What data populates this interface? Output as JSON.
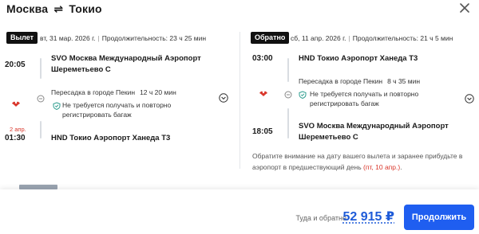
{
  "header": {
    "title_from": "Москва",
    "title_arrow": "⇌",
    "title_to": "Токио"
  },
  "outbound": {
    "badge": "Вылет",
    "date": "вт, 31 мар. 2026 г.",
    "duration": "Продолжительность: 23 ч 25 мин",
    "dep_time": "20:05",
    "dep_place_line1": "SVO Москва Международный Аэропорт",
    "dep_place_line2": "Шереметьево C",
    "transfer_city": "Пересадка в городе Пекин",
    "transfer_duration": "12 ч 20 мин",
    "bag_line1": "Не требуется получать и повторно",
    "bag_line2": "регистрировать багаж",
    "next_day": "2 апр.",
    "arr_time": "01:30",
    "arr_place": "HND Токио Аэропорт Ханеда T3"
  },
  "return": {
    "badge": "Обратно",
    "date": "сб, 11 апр. 2026 г.",
    "duration": "Продолжительность: 21 ч 5 мин",
    "dep_time": "03:00",
    "dep_place": "HND Токио Аэропорт Ханеда T3",
    "transfer_city": "Пересадка в городе Пекин",
    "transfer_duration": "8 ч 35 мин",
    "bag_line1": "Не требуется получать и повторно",
    "bag_line2": "регистрировать багаж",
    "arr_time": "18:05",
    "arr_place_line1": "SVO Москва Международный Аэропорт",
    "arr_place_line2": "Шереметьево C",
    "notice_line1": "Обратите внимание на дату вашего вылета и заранее прибудьте в",
    "notice_line2": "аэропорт в предшествующий день",
    "notice_highlight": "(пт, 10 апр.)",
    "notice_end": "."
  },
  "footer": {
    "price_label": "Туда и обратно",
    "price": "52 915 ₽",
    "continue_label": "Продолжить"
  },
  "colors": {
    "accent": "#1f5ef0",
    "price": "#1e5bd8",
    "warning": "#d9362b",
    "airline": "#d9362b"
  },
  "icons": {
    "close": "close-icon",
    "airline": "airline-logo-icon",
    "clock": "clock-icon",
    "shield": "shield-icon",
    "expand": "chevron-down-icon"
  }
}
